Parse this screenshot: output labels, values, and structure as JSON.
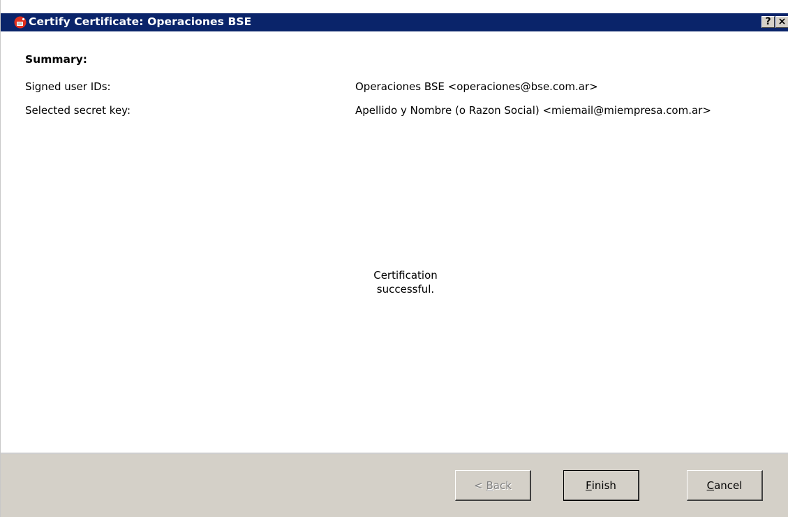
{
  "window": {
    "title": "Certify Certificate: Operaciones BSE",
    "help_label": "?",
    "close_label": "×"
  },
  "summary": {
    "heading": "Summary:",
    "signed_user_ids_label": "Signed user IDs:",
    "signed_user_ids_value": "Operaciones BSE <operaciones@bse.com.ar>",
    "secret_key_label": "Selected secret key:",
    "secret_key_value": "Apellido y Nombre (o Razon Social) <miemail@miempresa.com.ar>"
  },
  "status": {
    "line1": "Certification",
    "line2": "successful."
  },
  "buttons": {
    "back_prefix": "< ",
    "back_mnemonic": "B",
    "back_rest": "ack",
    "finish_mnemonic": "F",
    "finish_rest": "inish",
    "cancel_mnemonic": "C",
    "cancel_rest": "ancel"
  },
  "colors": {
    "titlebar": "#0a246a",
    "dialog_face": "#d4d0c8",
    "content_bg": "#ffffff"
  }
}
